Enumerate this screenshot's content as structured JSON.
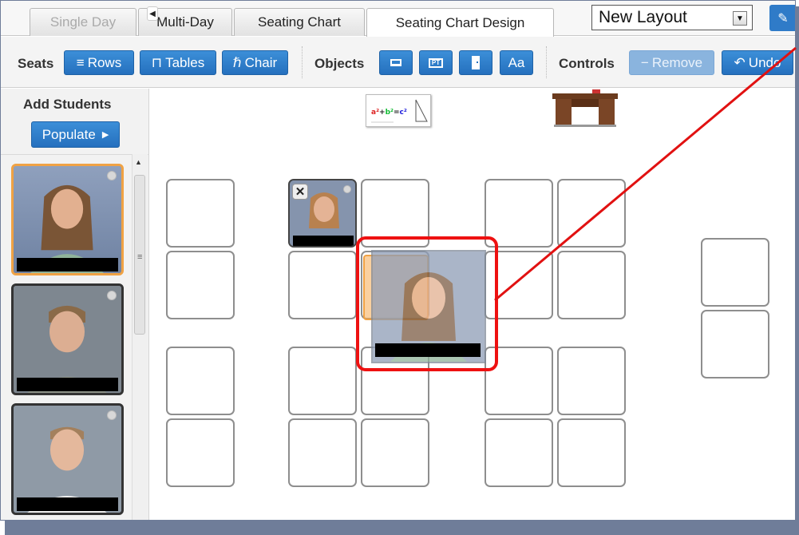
{
  "tabs": [
    {
      "label": "Single Day",
      "state": "disabled"
    },
    {
      "label": "Multi-Day",
      "state": "normal"
    },
    {
      "label": "Seating Chart",
      "state": "normal"
    },
    {
      "label": "Seating Chart Design",
      "state": "active"
    }
  ],
  "layout_select": {
    "value": "New Layout"
  },
  "toolbar": {
    "seats_label": "Seats",
    "rows_label": "Rows",
    "tables_label": "Tables",
    "chair_label": "Chair",
    "objects_label": "Objects",
    "text_label": "Aa",
    "controls_label": "Controls",
    "remove_label": "Remove",
    "undo_label": "Undo"
  },
  "sidebar": {
    "title": "Add Students",
    "populate_label": "Populate",
    "students": [
      {
        "selected": true
      },
      {
        "selected": false
      },
      {
        "selected": false
      }
    ]
  },
  "canvas": {
    "seat_count": 24,
    "occupied_seats": 1,
    "dragging_student": true
  },
  "colors": {
    "accent_blue": "#2f7bc8",
    "highlight_orange": "#f0a244",
    "annotation_red": "#e11111"
  }
}
